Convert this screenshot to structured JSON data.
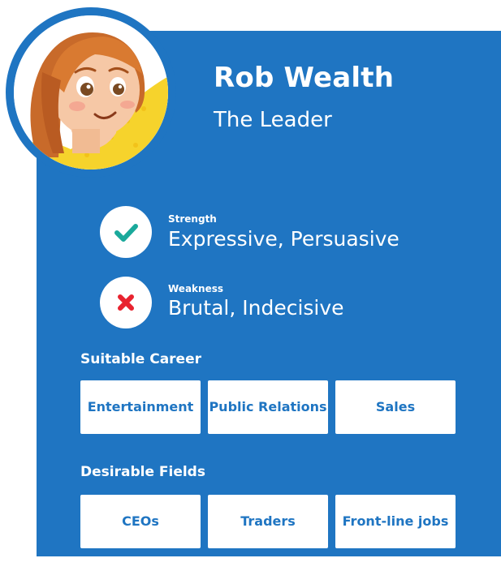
{
  "profile": {
    "name": "Rob Wealth",
    "subtitle": "The Leader"
  },
  "traits": [
    {
      "label": "Strength",
      "value": "Expressive, Persuasive",
      "icon": "check-icon",
      "icon_color": "#1aa99b"
    },
    {
      "label": "Weakness",
      "value": "Brutal, Indecisive",
      "icon": "cross-icon",
      "icon_color": "#e8232f"
    }
  ],
  "sections": {
    "career": {
      "title": "Suitable Career",
      "items": [
        "Entertainment",
        "Public Relations",
        "Sales"
      ]
    },
    "fields": {
      "title": "Desirable Fields",
      "items": [
        "CEOs",
        "Traders",
        "Front-line jobs"
      ]
    }
  },
  "colors": {
    "card_background": "#1f75c2",
    "tile_background": "#ffffff",
    "tile_text": "#1f75c2"
  }
}
